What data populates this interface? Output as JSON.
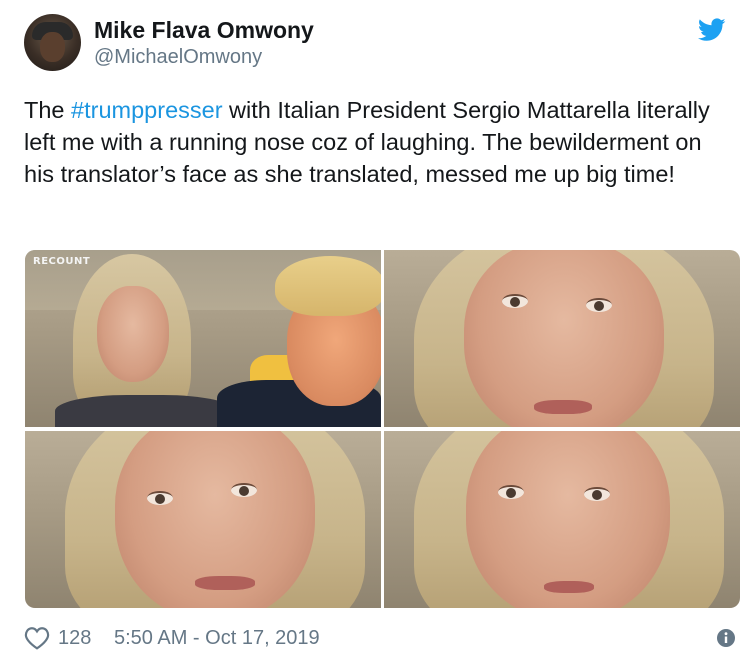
{
  "user": {
    "display_name": "Mike Flava Omwony",
    "handle": "@MichaelOmwony"
  },
  "tweet": {
    "text_before": "The ",
    "hashtag": "#trumppresser",
    "text_after": " with Italian President Sergio Mattarella literally left me with a running nose coz of laughing. The bewilderment on his translator’s face as she translated, messed me up big time!"
  },
  "media": {
    "watermark": "RECOUNT"
  },
  "footer": {
    "likes": "128",
    "timestamp": "5:50 AM - Oct 17, 2019"
  },
  "icons": {
    "brand": "twitter-bird-icon",
    "like": "heart-icon",
    "info": "info-icon"
  },
  "colors": {
    "twitter_blue": "#1da1f2",
    "hashtag": "#1b95e0",
    "secondary_text": "#657786",
    "primary_text": "#14171a"
  }
}
